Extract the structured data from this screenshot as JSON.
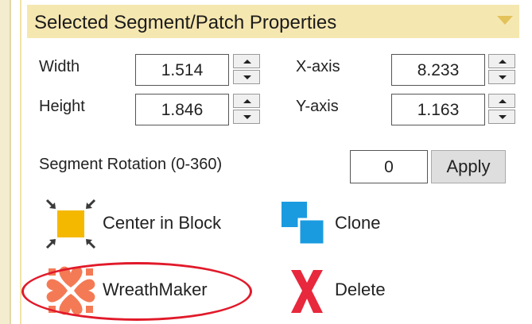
{
  "panel": {
    "title": "Selected Segment/Patch Properties"
  },
  "dimensions": {
    "width_label": "Width",
    "width_value": "1.514",
    "height_label": "Height",
    "height_value": "1.846",
    "xaxis_label": "X-axis",
    "xaxis_value": "8.233",
    "yaxis_label": "Y-axis",
    "yaxis_value": "1.163"
  },
  "rotation": {
    "label": "Segment Rotation (0-360)",
    "value": "0",
    "apply_label": "Apply"
  },
  "actions": {
    "center_label": "Center in Block",
    "clone_label": "Clone",
    "wreath_label": "WreathMaker",
    "delete_label": "Delete"
  },
  "colors": {
    "header_bg": "#f5e7b0",
    "accent_orange": "#f5b800",
    "clone_blue": "#1a9be0",
    "wreath_coral": "#f47a55",
    "delete_red": "#e8283c",
    "highlight_red": "#e11a2a"
  },
  "icons": {
    "center": "center-in-block-icon",
    "clone": "clone-icon",
    "wreath": "wreathmaker-icon",
    "delete": "delete-x-icon"
  }
}
